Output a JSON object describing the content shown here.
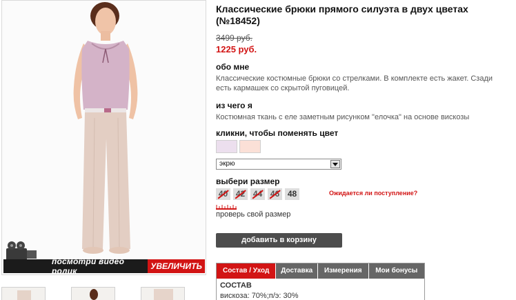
{
  "product": {
    "title": "Классические брюки прямого силуэта в двух цветах (№18452)",
    "old_price": "3499 руб.",
    "new_price": "1225 руб."
  },
  "photo": {
    "video_label": "посмотри видео ролик",
    "zoom_label": "УВЕЛИЧИТЬ"
  },
  "about": {
    "heading": "обо мне",
    "text": "Классические костюмные брюки со стрелками. В комплекте есть жакет. Сзади есть кармашек со скрытой пуговицей."
  },
  "material": {
    "heading": "из чего я",
    "text": "Костюмная ткань с еле заметным рисунком \"елочка\" на основе вискозы"
  },
  "color": {
    "heading": "кликни, чтобы поменять цвет",
    "swatches": [
      "#ecdfee",
      "#fbe0d7"
    ],
    "selected": "экрю"
  },
  "size": {
    "heading": "выбери размер",
    "options": [
      {
        "label": "40",
        "available": false
      },
      {
        "label": "42",
        "available": false
      },
      {
        "label": "44",
        "available": false
      },
      {
        "label": "46",
        "available": false
      },
      {
        "label": "48",
        "available": true
      }
    ],
    "notify_label": "Ожидается ли поступление?",
    "check_label": "проверь свой размер"
  },
  "cart": {
    "button_label": "добавить в корзину"
  },
  "tabs": {
    "items": [
      "Состав / Уход",
      "Доставка",
      "Измерения",
      "Мои бонусы"
    ],
    "active_index": 0,
    "content_heading": "СОСТАВ",
    "content_line": "вискоза: 70%;п/э: 30%"
  },
  "colors": {
    "accent": "#d21414",
    "button": "#4d4d4d",
    "tab_inactive": "#666666"
  }
}
